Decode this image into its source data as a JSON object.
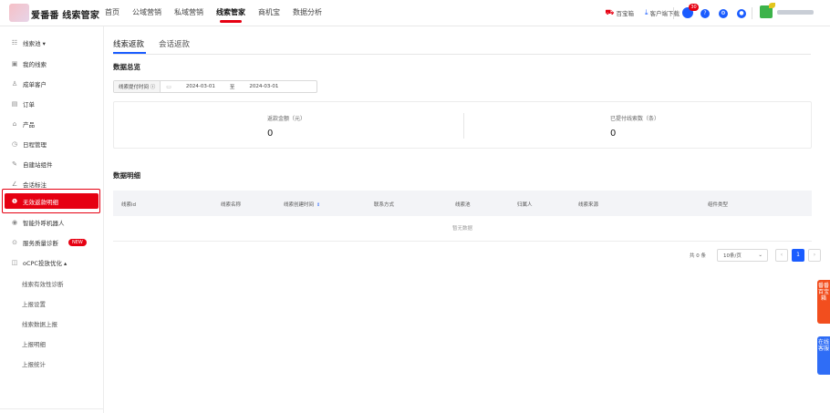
{
  "header": {
    "brand": "爱番番 线索管家",
    "nav": [
      "首页",
      "公域营销",
      "私域营销",
      "线索管家",
      "商机宝",
      "数据分析"
    ],
    "active_nav": "线索管家",
    "tools": [
      {
        "icon": "cart-icon",
        "label": "百宝箱"
      },
      {
        "icon": "download-icon",
        "label": "客户端下载"
      }
    ],
    "notification_count": "30"
  },
  "sidebar": {
    "items": [
      {
        "label": "线索池 ▾",
        "icon": "list-icon"
      },
      {
        "label": "我的线索",
        "icon": "inbox-icon"
      },
      {
        "label": "成单客户",
        "icon": "user-icon"
      },
      {
        "label": "订单",
        "icon": "order-icon"
      },
      {
        "label": "产品",
        "icon": "product-icon"
      },
      {
        "label": "日程管理",
        "icon": "schedule-icon"
      },
      {
        "label": "自建站组件",
        "icon": "edit-icon"
      },
      {
        "label": "会话标注",
        "icon": "pen-icon"
      },
      {
        "label": "无效返款明细",
        "icon": "money-icon",
        "active": true
      },
      {
        "label": "智能外呼机器人",
        "icon": "robot-icon"
      },
      {
        "label": "服务质量诊断",
        "icon": "diagnose-icon",
        "badge": "NEW"
      },
      {
        "label": "oCPC投放优化 ▴",
        "icon": "ocpc-icon"
      }
    ],
    "sub_items": [
      "线索有效性诊断",
      "上报设置",
      "线索数据上报",
      "上报明细",
      "上报统计"
    ]
  },
  "main": {
    "tabs": [
      "线索返款",
      "会话返款"
    ],
    "active_tab": "线索返款",
    "overview_title": "数据总览",
    "filter": {
      "label": "线索提付时间 ⓘ",
      "start": "2024-03-01",
      "sep": "至",
      "end": "2024-03-01"
    },
    "stats": [
      {
        "label": "返款金额（元）",
        "value": "0"
      },
      {
        "label": "已提付线索数（条）",
        "value": "0"
      }
    ],
    "detail_title": "数据明细",
    "table": {
      "columns": [
        "线索id",
        "线索名称",
        "线索创建时间",
        "联系方式",
        "线索池",
        "归属人",
        "线索来源",
        "组件类型"
      ],
      "empty_text": "暂无数据"
    },
    "pager": {
      "total": "共 0 条",
      "page_size": "10条/页",
      "current_page": "1"
    }
  },
  "floating": {
    "red_tab": "番番百宝箱",
    "blue_tab": "在线客服"
  }
}
